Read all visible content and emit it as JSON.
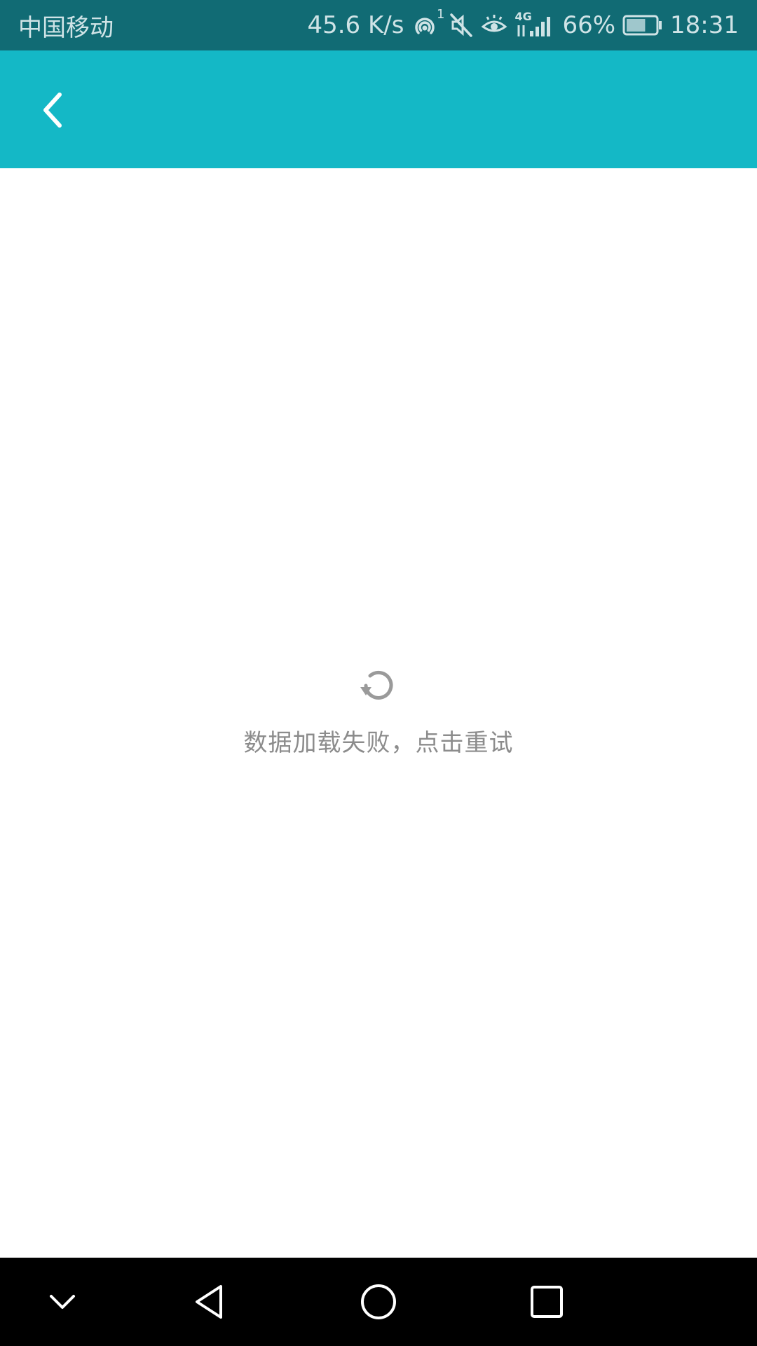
{
  "status_bar": {
    "carrier": "中国移动",
    "net_speed": "45.6 K/s",
    "hotspot_badge": "1",
    "network_type": "4G",
    "battery_percent": "66%",
    "battery_level": 0.66,
    "time": "18:31",
    "icons": [
      "hotspot-icon",
      "mute-icon",
      "eye-comfort-icon",
      "signal-4g-icon",
      "battery-icon"
    ]
  },
  "toolbar": {
    "back_icon": "chevron-left-icon",
    "color": "#14b8c6"
  },
  "content": {
    "retry_icon": "refresh-icon",
    "error_message": "数据加载失败，点击重试"
  },
  "nav_bar": {
    "items": [
      "collapse-icon",
      "back-triangle-icon",
      "home-circle-icon",
      "recents-square-icon"
    ]
  },
  "colors": {
    "status_bar": "#116b74",
    "toolbar": "#14b8c6",
    "message_text": "#8c8c8c",
    "nav_bar": "#000000"
  }
}
